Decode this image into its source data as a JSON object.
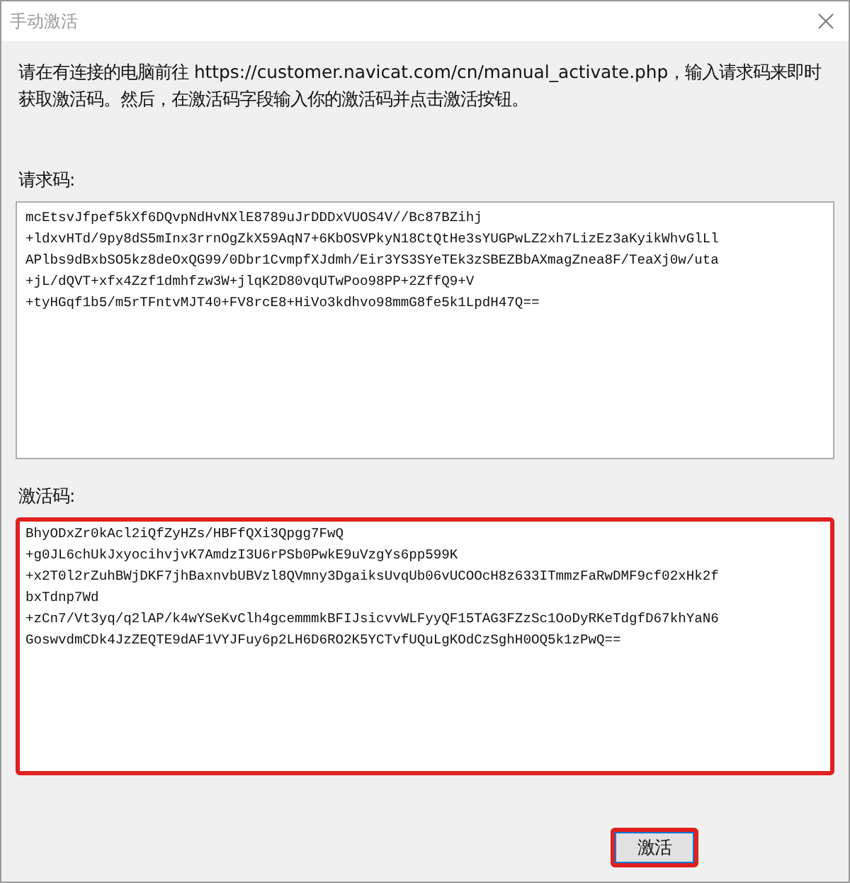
{
  "window": {
    "title": "手动激活"
  },
  "instructions": "请在有连接的电脑前往 https://customer.navicat.com/cn/manual_activate.php，输入请求码来即时获取激活码。然后，在激活码字段输入你的激活码并点击激活按钮。",
  "request_code": {
    "label": "请求码:",
    "lines": [
      "mcEtsvJfpef5kXf6DQvpNdHvNXlE8789uJrDDDxVUOS4V//Bc87BZihj",
      "+ldxvHTd/9py8dS5mInx3rrnOgZkX59AqN7+6KbOSVPkyN18CtQtHe3sYUGPwLZ2xh7LizEz3aKyikWhvGlLl",
      "APlbs9dBxbSO5kz8deOxQG99/0Dbr1CvmpfXJdmh/Eir3YS3SYeTEk3zSBEZBbAXmagZnea8F/TeaXj0w/uta",
      "+jL/dQVT+xfx4Zzf1dmhfzw3W+jlqK2D80vqUTwPoo98PP+2ZffQ9+V",
      "+tyHGqf1b5/m5rTFntvMJT40+FV8rcE8+HiVo3kdhvo98mmG8fe5k1LpdH47Q=="
    ]
  },
  "activation_code": {
    "label": "激活码:",
    "lines": [
      "BhyODxZr0kAcl2iQfZyHZs/HBFfQXi3Qpgg7FwQ",
      "+g0JL6chUkJxyocihvjvK7AmdzI3U6rPSb0PwkE9uVzgYs6pp599K",
      "+x2T0l2rZuhBWjDKF7jhBaxnvbUBVzl8QVmny3DgaiksUvqUb06vUCOOcH8z633ITmmzFaRwDMF9cf02xHk2f",
      "bxTdnp7Wd",
      "+zCn7/Vt3yq/q2lAP/k4wYSeKvClh4gcemmmkBFIJsicvvWLFyyQF15TAG3FZzSc1OoDyRKeTdgfD67khYaN6",
      "GoswvdmCDk4JzZEQTE9dAF1VYJFuy6p2LH6D6RO2K5YCTvfUQuLgKOdCzSghH0OQ5k1zPwQ=="
    ]
  },
  "buttons": [
    {
      "label": "激活"
    }
  ]
}
